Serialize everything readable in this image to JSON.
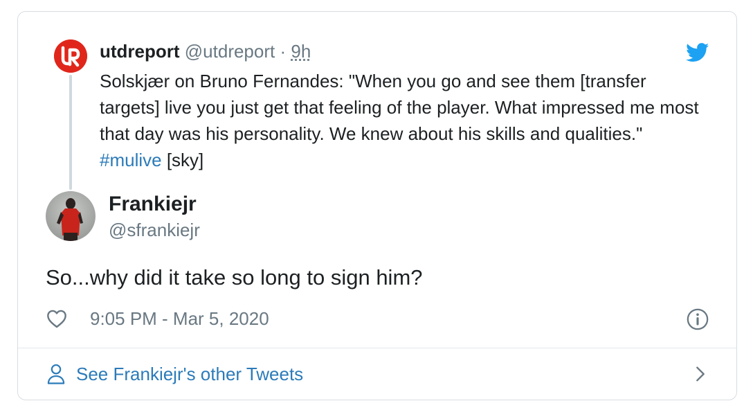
{
  "quoted_tweet": {
    "name": "utdreport",
    "handle": "@utdreport",
    "separator": "·",
    "time": "9h",
    "text_before_hashtag": "Solskjær on Bruno Fernandes: \"When you go and see them [transfer targets] live you just get that feeling of the player. What impressed me most that day was his personality. We knew about his skills and qualities.\" ",
    "hashtag": "#mulive",
    "text_after_hashtag": " [sky]",
    "avatar_icon": "utdreport-logo-icon"
  },
  "reply_tweet": {
    "name": "Frankiejr",
    "handle": "@sfrankiejr",
    "text": "So...why did it take so long to sign him?",
    "timestamp": "9:05 PM - Mar 5, 2020"
  },
  "footer": {
    "link_label": "See Frankiejr's other Tweets"
  },
  "colors": {
    "link": "#2b7bb9",
    "muted": "#697882",
    "text": "#1c2022",
    "twitter_blue": "#1da1f2",
    "brand_red": "#e0261b"
  },
  "icons": [
    "twitter-bird-icon",
    "heart-icon",
    "info-icon",
    "person-icon",
    "chevron-right-icon"
  ]
}
